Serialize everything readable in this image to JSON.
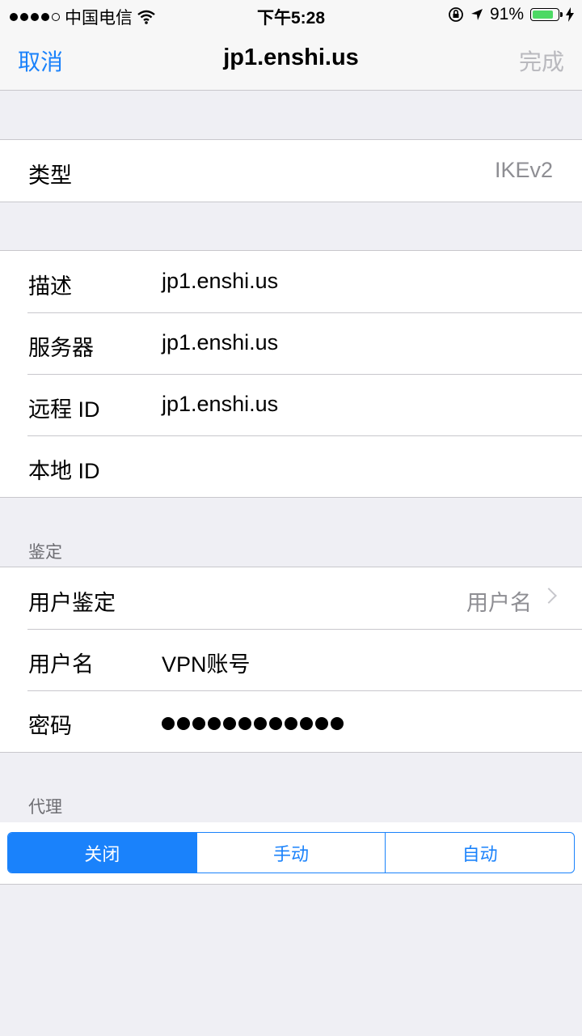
{
  "status_bar": {
    "carrier": "中国电信",
    "time": "下午5:28",
    "battery_percent": "91%",
    "battery_level": 0.91,
    "icons": [
      "wifi-icon",
      "orientation-lock-icon",
      "location-arrow-icon",
      "battery-icon",
      "charging-bolt-icon"
    ]
  },
  "nav": {
    "cancel": "取消",
    "title": "jp1.enshi.us",
    "done": "完成"
  },
  "type_row": {
    "label": "类型",
    "value": "IKEv2"
  },
  "connection": {
    "description_label": "描述",
    "description_value": "jp1.enshi.us",
    "server_label": "服务器",
    "server_value": "jp1.enshi.us",
    "remote_id_label": "远程 ID",
    "remote_id_value": "jp1.enshi.us",
    "local_id_label": "本地 ID",
    "local_id_value": ""
  },
  "auth": {
    "header": "鉴定",
    "user_auth_label": "用户鉴定",
    "user_auth_value": "用户名",
    "username_label": "用户名",
    "username_value": "VPN账号",
    "password_label": "密码",
    "password_length": 12
  },
  "proxy": {
    "header": "代理",
    "options": [
      "关闭",
      "手动",
      "自动"
    ],
    "selected": "关闭"
  },
  "colors": {
    "accent": "#1a82fb",
    "background": "#efeff4",
    "battery": "#4cd964",
    "disabled": "#b9b9be"
  }
}
